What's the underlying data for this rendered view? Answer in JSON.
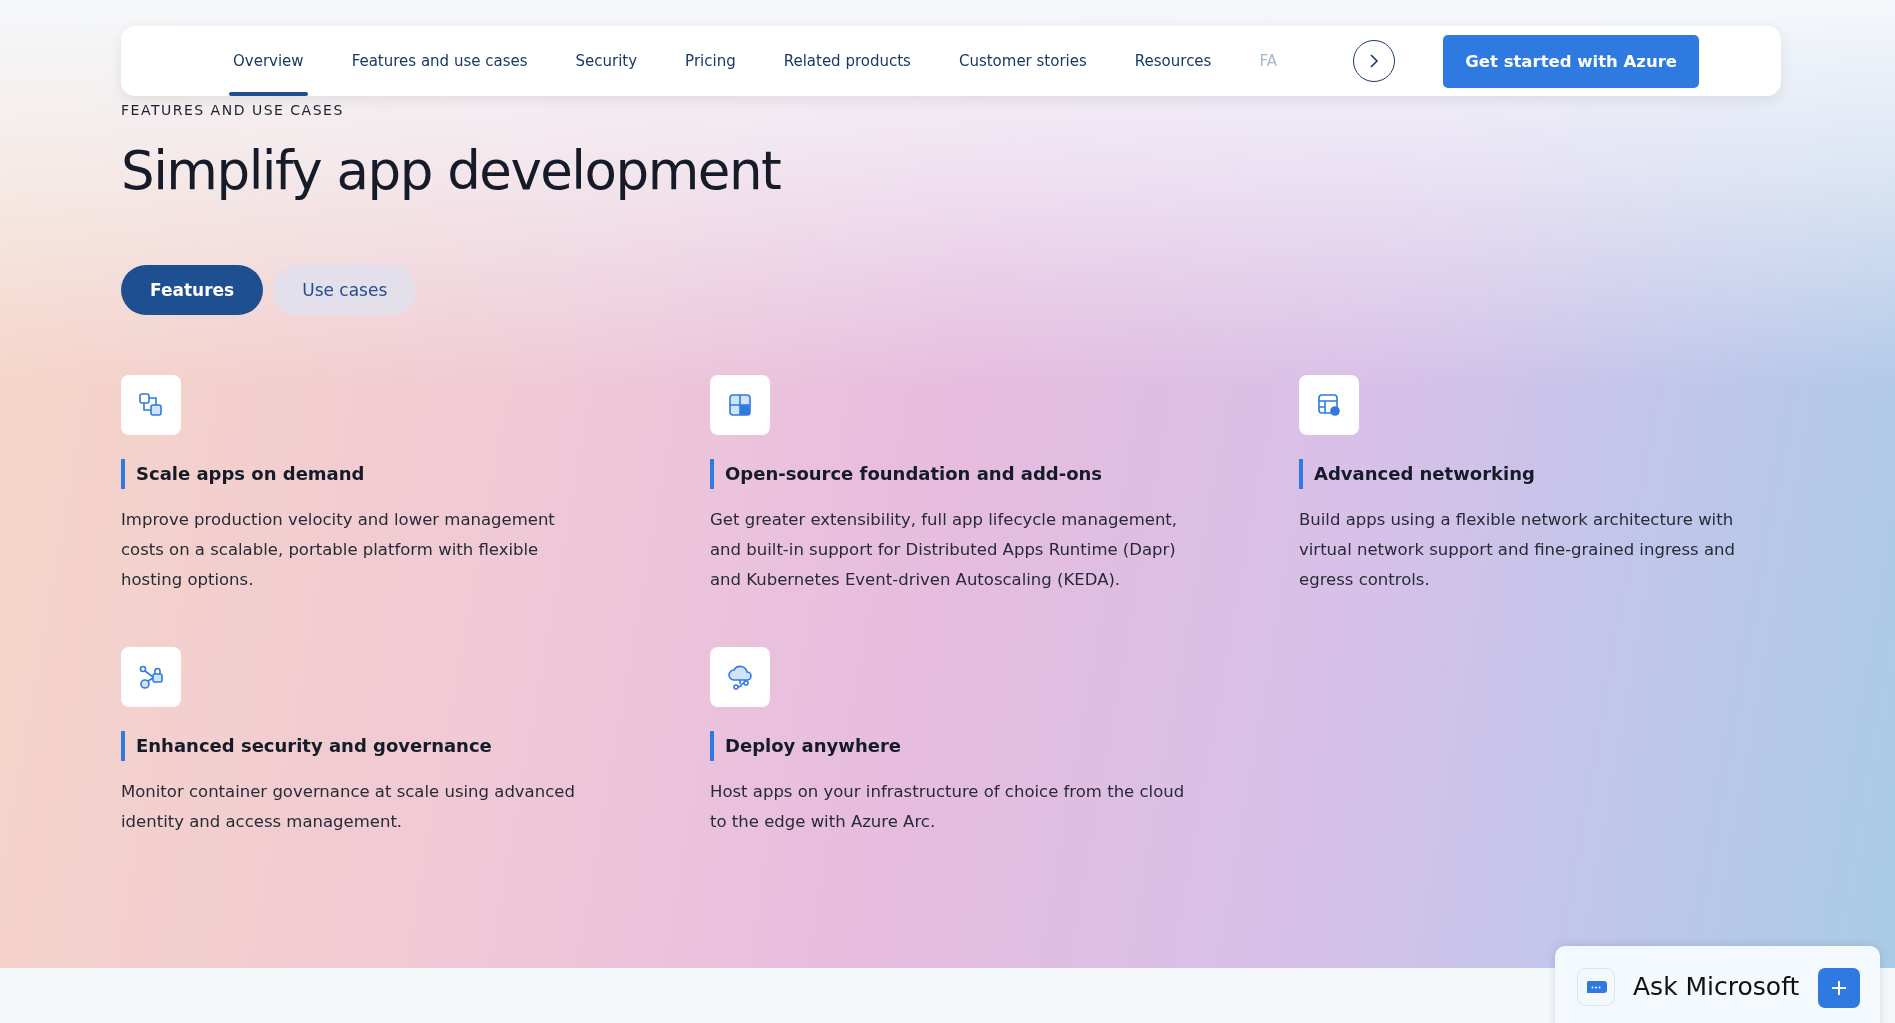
{
  "nav": {
    "items": [
      {
        "label": "Overview",
        "selected": true
      },
      {
        "label": "Features and use cases",
        "selected": false
      },
      {
        "label": "Security",
        "selected": false
      },
      {
        "label": "Pricing",
        "selected": false
      },
      {
        "label": "Related products",
        "selected": false
      },
      {
        "label": "Customer stories",
        "selected": false
      },
      {
        "label": "Resources",
        "selected": false
      },
      {
        "label": "FA",
        "selected": false
      }
    ],
    "cta": "Get started with Azure"
  },
  "eyebrow": "FEATURES AND USE CASES",
  "title": "Simplify app development",
  "tabs": [
    {
      "label": "Features",
      "selected": true
    },
    {
      "label": "Use cases",
      "selected": false
    }
  ],
  "features": [
    {
      "title": "Scale apps on demand",
      "description": "Improve production velocity and lower management costs on a scalable, portable platform with flexible hosting options."
    },
    {
      "title": "Open-source foundation and add-ons",
      "description": "Get greater extensibility, full app lifecycle management, and built-in support for Distributed Apps Runtime (Dapr) and Kubernetes Event-driven Autoscaling (KEDA)."
    },
    {
      "title": "Advanced networking",
      "description": "Build apps using a flexible network architecture with virtual network support and fine-grained ingress and egress controls."
    },
    {
      "title": "Enhanced security and governance",
      "description": "Monitor container governance at scale using advanced identity and access management."
    },
    {
      "title": "Deploy anywhere",
      "description": "Host apps on your infrastructure of choice from the cloud to the edge with Azure Arc."
    }
  ],
  "chat": {
    "label": "Ask Microsoft"
  }
}
